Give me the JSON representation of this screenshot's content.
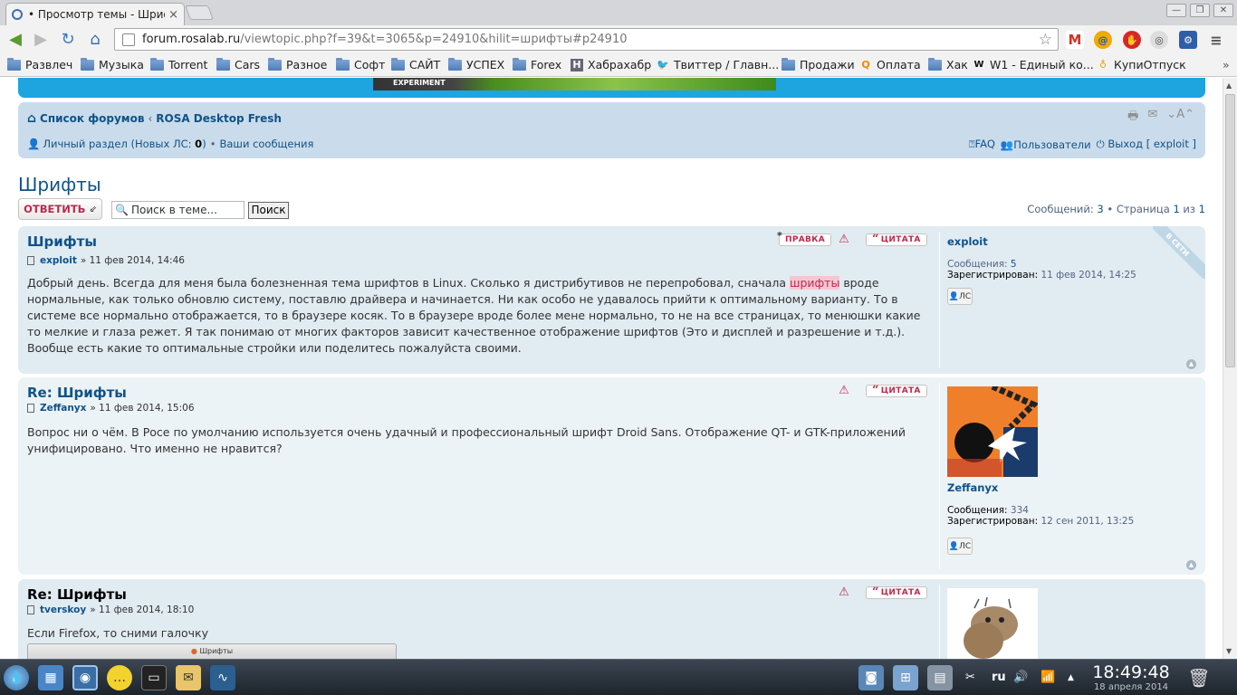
{
  "browser": {
    "tab_title": "• Просмотр темы - Шриф",
    "tab_close": "×",
    "url_host": "forum.rosalab.ru",
    "url_path": "/viewtopic.php?f=39&t=3065&p=24910&hilit=шрифты#p24910",
    "window_buttons": [
      "—",
      "❐",
      "✕"
    ],
    "extensions": [
      "gmail-icon",
      "mail-icon",
      "adblock-icon",
      "ghost-icon",
      "settings-icon",
      "menu-icon"
    ],
    "bookmarks": [
      {
        "label": "Развлеч",
        "icon": "folder"
      },
      {
        "label": "Музыка",
        "icon": "folder"
      },
      {
        "label": "Torrent",
        "icon": "folder"
      },
      {
        "label": "Cars",
        "icon": "folder"
      },
      {
        "label": "Разное",
        "icon": "folder"
      },
      {
        "label": "Софт",
        "icon": "folder"
      },
      {
        "label": "САЙТ",
        "icon": "folder"
      },
      {
        "label": "УСПЕХ",
        "icon": "folder"
      },
      {
        "label": "Forex",
        "icon": "folder"
      },
      {
        "label": "Хабрахабр",
        "icon": "H"
      },
      {
        "label": "Твиттер / Главн...",
        "icon": "twitter"
      },
      {
        "label": "Продажи",
        "icon": "folder"
      },
      {
        "label": "Оплата",
        "icon": "Q"
      },
      {
        "label": "Хак",
        "icon": "folder"
      },
      {
        "label": "W1 - Единый ко...",
        "icon": "W"
      },
      {
        "label": "КупиОтпуск",
        "icon": "K"
      }
    ]
  },
  "banner": {
    "text": "EXPERIMENT"
  },
  "navbar": {
    "crumb_1": "Список форумов",
    "crumb_sep": "‹",
    "crumb_2": "ROSA Desktop Fresh",
    "font_toggle": "A",
    "pm_label": "Личный раздел (Новых ЛС: ",
    "pm_count": "0",
    "pm_close": ")",
    "bullet": "•",
    "your_messages": "Ваши сообщения",
    "faq": "FAQ",
    "users": "Пользователи",
    "logout": "Выход [ exploit ]"
  },
  "topic": {
    "title": "Шрифты",
    "reply_button": "ОТВЕТИТЬ",
    "search_placeholder": "Поиск в теме...",
    "search_button": "Поиск",
    "pagination": {
      "prefix": "Сообщений: ",
      "count": "3",
      "sep": " • Страница ",
      "page": "1",
      "of": " из ",
      "total": "1"
    }
  },
  "posts": [
    {
      "title": "Шрифты",
      "author": "exploit",
      "date": "» 11 фев 2014, 14:46",
      "edit_button": "ПРАВКА",
      "quote_button": "ЦИТАТА",
      "content_before": "Добрый день. Всегда для меня была болезненная тема шрифтов в Linux. Сколько я дистрибутивов не перепробовал, сначала ",
      "content_highlight": "шрифты",
      "content_after": " вроде нормальные, как только обновлю систему, поставлю драйвера и начинается. Ни как особо не удавалось прийти к оптимальному варианту. То в системе все нормально отображается, то в браузере косяк. То в браузере вроде более мене нормально, то не на все страницах, то менюшки какие то мелкие и глаза режет. Я так понимаю от многих факторов зависит качественное отображение шрифтов (Это и дисплей и разрешение и т.д.). Вообще есть какие то оптимальные стройки или поделитесь пожалуйста своими.",
      "online_badge": "В СЕТИ",
      "profile": {
        "name": "exploit",
        "posts_label": "Сообщения:",
        "posts": "5",
        "reg_label": "Зарегистрирован:",
        "reg_date": "11 фев 2014, 14:25",
        "pm_button": "ЛС"
      }
    },
    {
      "title": "Re: Шрифты",
      "author": "Zeffanyx",
      "date": "» 11 фев 2014, 15:06",
      "quote_button": "ЦИТАТА",
      "content": "Вопрос ни о чём. В Росе по умолчанию используется очень удачный и профессиональный шрифт Droid Sans. Отображение QT- и GTK-приложений унифицировано. Что именно не нравится?",
      "profile": {
        "name": "Zeffanyx",
        "posts_label": "Сообщения:",
        "posts": "334",
        "reg_label": "Зарегистрирован:",
        "reg_date": "12 сен 2011, 13:25",
        "pm_button": "ЛС"
      }
    },
    {
      "title": "Re: Шрифты",
      "author": "tverskoy",
      "date": "» 11 фев 2014, 18:10",
      "quote_button": "ЦИТАТА",
      "content": "Если Firefox, то сними галочку",
      "screenshot_title": "Шрифты"
    }
  ],
  "taskbar": {
    "lang": "ru",
    "time": "18:49:48",
    "date": "18 апреля 2014"
  }
}
